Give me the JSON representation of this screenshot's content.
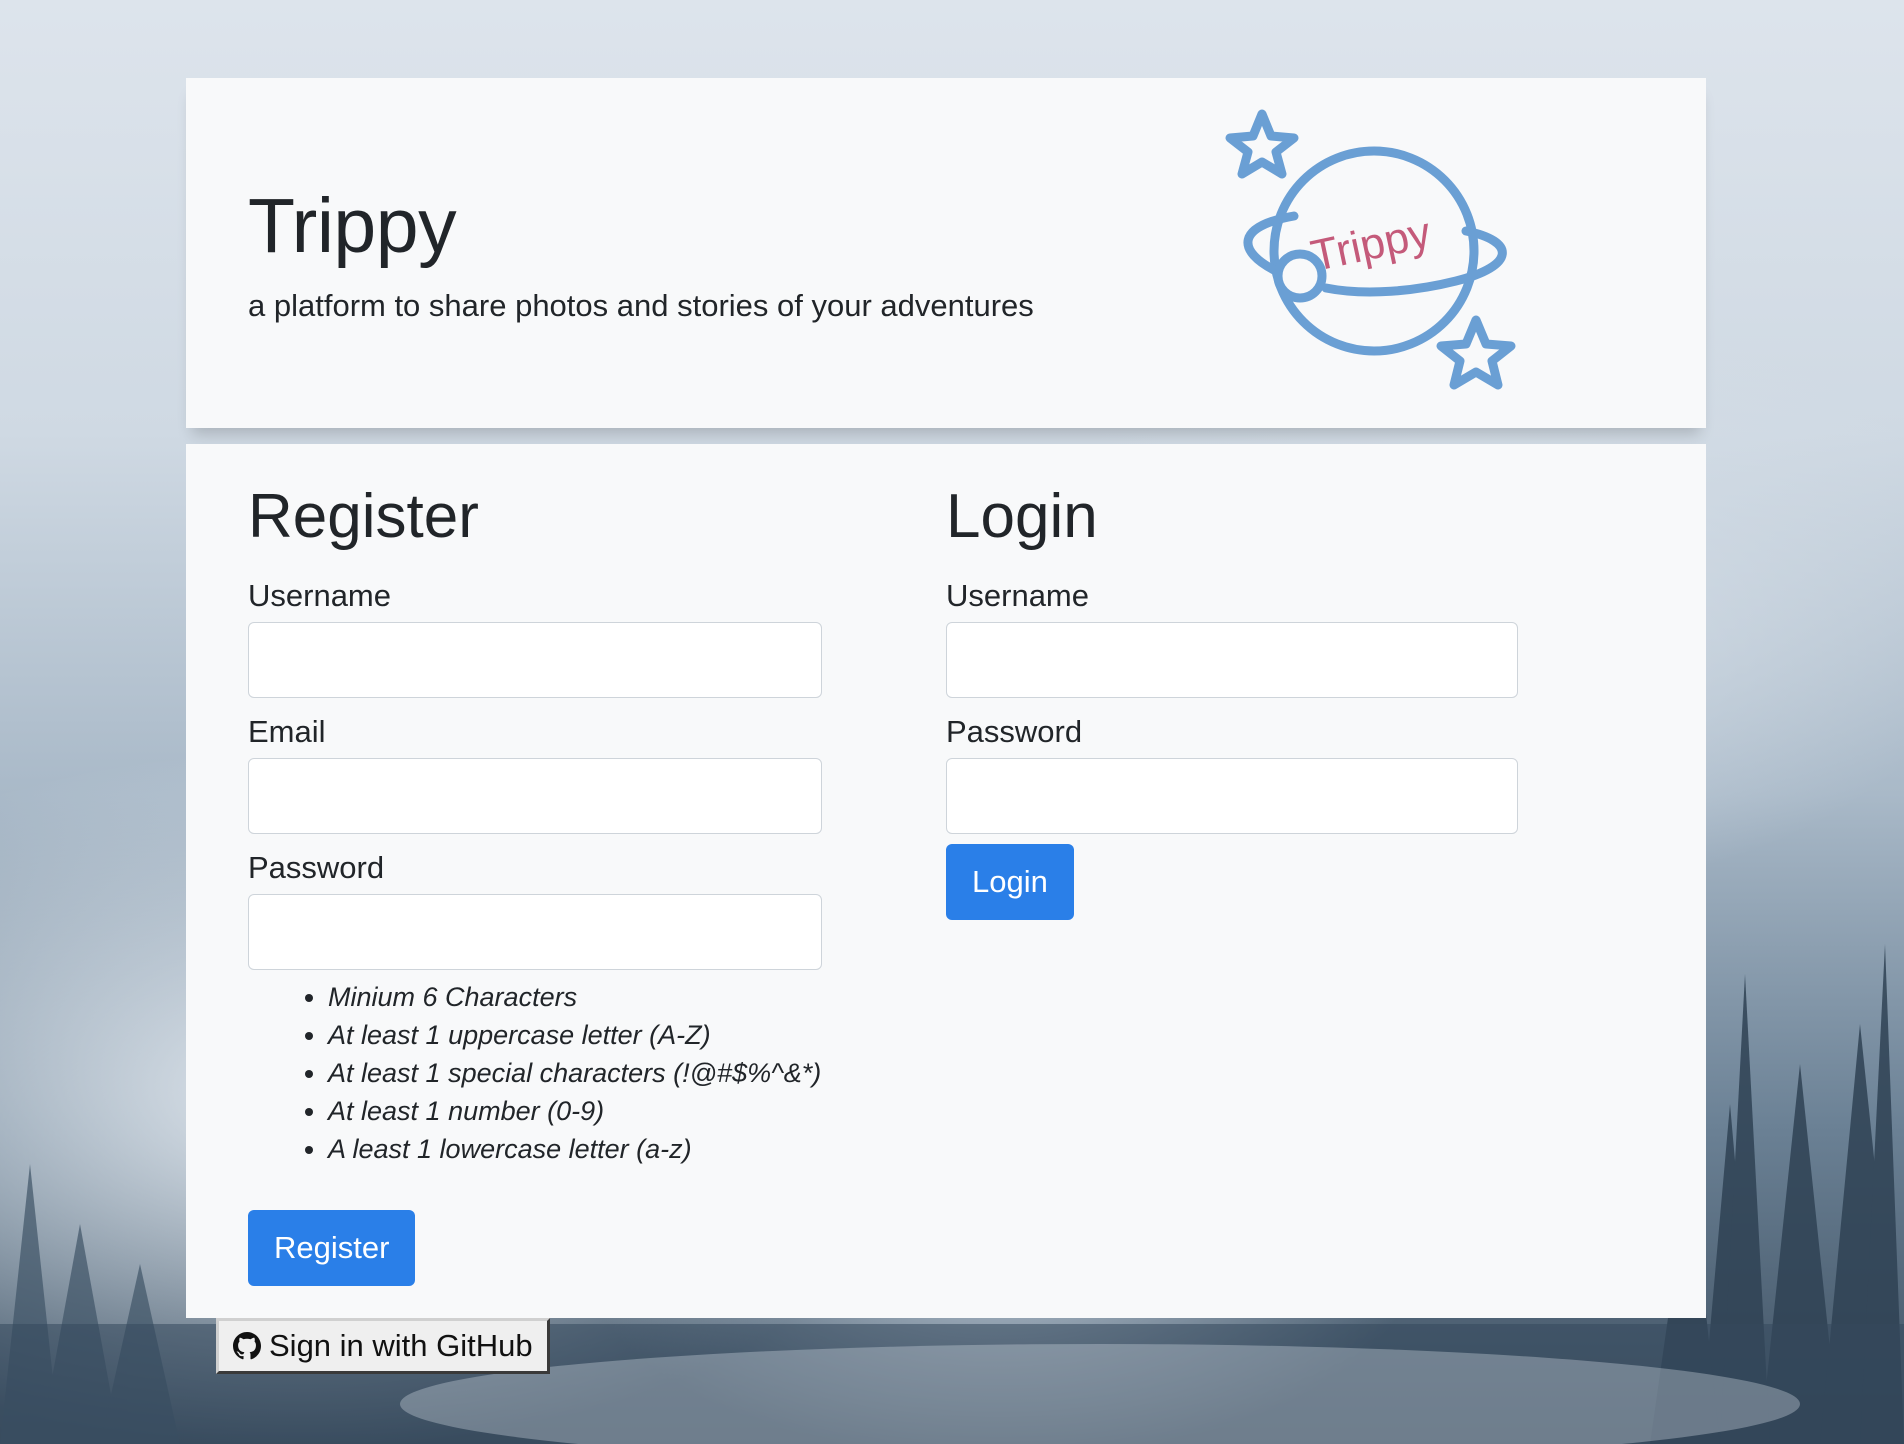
{
  "hero": {
    "title": "Trippy",
    "subtitle": "a platform to share photos and stories of your adventures",
    "logo_text": "Trippy"
  },
  "register": {
    "heading": "Register",
    "username_label": "Username",
    "email_label": "Email",
    "password_label": "Password",
    "rules": [
      "Minium 6 Characters",
      "At least 1 uppercase letter (A-Z)",
      "At least 1 special characters (!@#$%^&*)",
      "At least 1 number (0-9)",
      "A least 1 lowercase letter (a-z)"
    ],
    "button_label": "Register"
  },
  "login": {
    "heading": "Login",
    "username_label": "Username",
    "password_label": "Password",
    "button_label": "Login"
  },
  "github": {
    "button_label": "Sign in with GitHub",
    "icon": "github-icon"
  },
  "colors": {
    "primary": "#2a7fe8",
    "logo_blue": "#6a9fd4",
    "logo_text": "#c45a7a",
    "card_bg": "#f8f9fa"
  }
}
